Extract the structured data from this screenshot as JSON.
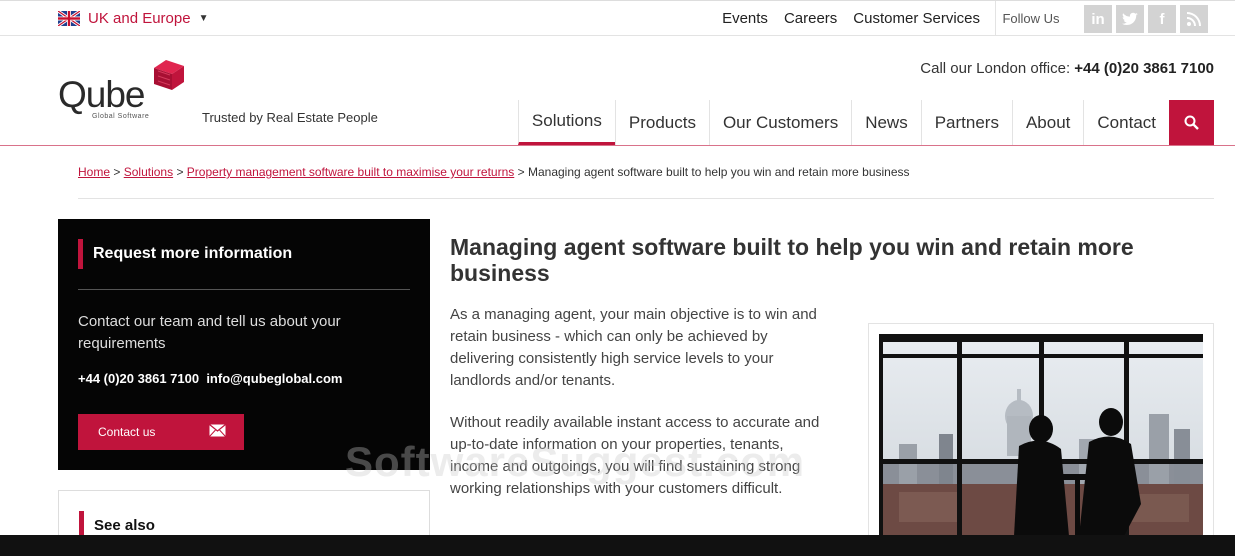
{
  "topbar": {
    "region": "UK and Europe",
    "links": [
      "Events",
      "Careers",
      "Customer Services"
    ],
    "follow_label": "Follow Us",
    "social": [
      {
        "name": "linkedin-icon",
        "glyph": "in"
      },
      {
        "name": "twitter-icon",
        "glyph": "t"
      },
      {
        "name": "facebook-icon",
        "glyph": "f"
      },
      {
        "name": "rss-icon",
        "glyph": "◢"
      }
    ]
  },
  "header": {
    "logo_text": "Qube",
    "logo_sub": "Global Software",
    "tagline": "Trusted by Real Estate People",
    "call_label": "Call our London office:",
    "call_number": "+44 (0)20 3861 7100"
  },
  "nav": {
    "items": [
      "Solutions",
      "Products",
      "Our Customers",
      "News",
      "Partners",
      "About",
      "Contact"
    ],
    "active": "Solutions"
  },
  "breadcrumb": {
    "home": "Home",
    "solutions": "Solutions",
    "parent": "Property management software built to maximise your returns",
    "current": "Managing agent software built to help you win and retain more business",
    "sep": ">"
  },
  "sidebar": {
    "title": "Request more information",
    "text": "Contact our team and tell us about your requirements",
    "phone": "+44 (0)20 3861 7100",
    "email": "info@qubeglobal.com",
    "button": "Contact us",
    "see_also": "See also"
  },
  "main": {
    "heading": "Managing agent software built to help you win and retain more business",
    "para1": "As a managing agent, your main objective is to win and retain business - which can only be achieved by delivering consistently high service levels to your landlords and/or tenants.",
    "para2": "Without readily available instant access to accurate and up-to-date information on your properties, tenants, income and outgoings, you will find sustaining strong working relationships with your customers difficult."
  },
  "watermark": "SoftwareSuggest.com",
  "colors": {
    "accent": "#c0143c",
    "dark": "#050505"
  }
}
